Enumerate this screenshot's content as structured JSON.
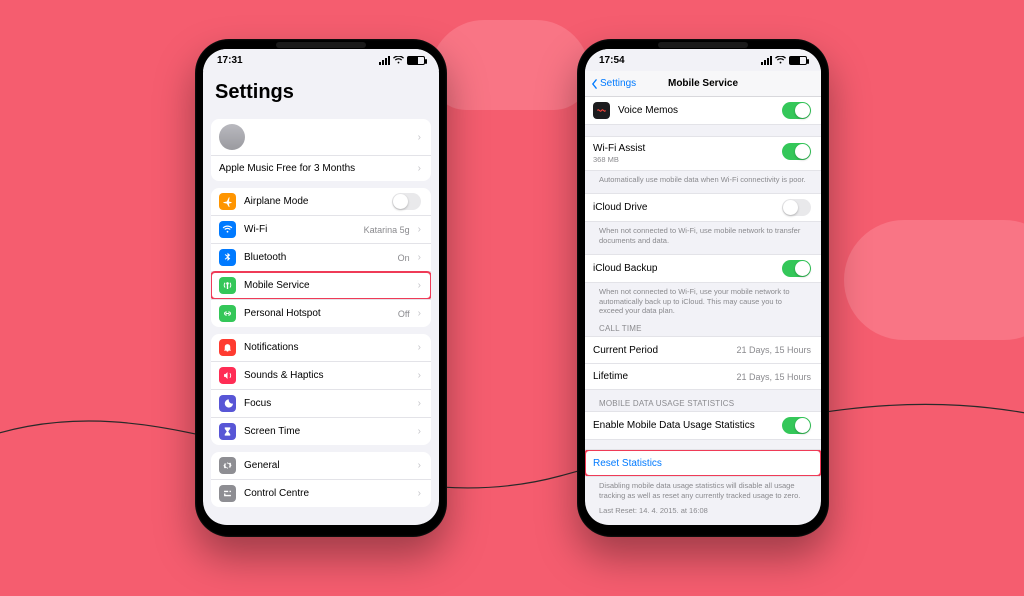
{
  "left": {
    "status": {
      "time": "17:31"
    },
    "title": "Settings",
    "account": {
      "promo": "Apple Music Free for 3 Months"
    },
    "g1": [
      {
        "icon": "airplane-icon",
        "color": "ic-orange",
        "label": "Airplane Mode",
        "toggle": false
      },
      {
        "icon": "wifi-icon",
        "color": "ic-blue",
        "label": "Wi-Fi",
        "value": "Katarina 5g"
      },
      {
        "icon": "bluetooth-icon",
        "color": "ic-blue",
        "label": "Bluetooth",
        "value": "On"
      },
      {
        "icon": "antenna-icon",
        "color": "ic-green",
        "label": "Mobile Service",
        "highlight": true
      },
      {
        "icon": "link-icon",
        "color": "ic-green",
        "label": "Personal Hotspot",
        "value": "Off"
      }
    ],
    "g2": [
      {
        "icon": "bell-icon",
        "color": "ic-red",
        "label": "Notifications"
      },
      {
        "icon": "speaker-icon",
        "color": "ic-pink",
        "label": "Sounds & Haptics"
      },
      {
        "icon": "moon-icon",
        "color": "ic-indigo",
        "label": "Focus"
      },
      {
        "icon": "hourglass-icon",
        "color": "ic-indigo",
        "label": "Screen Time"
      }
    ],
    "g3": [
      {
        "icon": "gear-icon",
        "color": "ic-grey",
        "label": "General"
      },
      {
        "icon": "switches-icon",
        "color": "ic-grey",
        "label": "Control Centre"
      }
    ]
  },
  "right": {
    "status": {
      "time": "17:54"
    },
    "nav": {
      "back": "Settings",
      "title": "Mobile Service"
    },
    "voiceMemos": {
      "label": "Voice Memos",
      "on": true
    },
    "wifiAssist": {
      "label": "Wi-Fi Assist",
      "sub": "368 MB",
      "on": true,
      "footer": "Automatically use mobile data when Wi-Fi connectivity is poor."
    },
    "icloudDrive": {
      "label": "iCloud Drive",
      "on": false,
      "footer": "When not connected to Wi-Fi, use mobile network to transfer documents and data."
    },
    "icloudBackup": {
      "label": "iCloud Backup",
      "on": true,
      "footer": "When not connected to Wi-Fi, use your mobile network to automatically back up to iCloud. This may cause you to exceed your data plan."
    },
    "callTimeHeader": "CALL TIME",
    "callTime": [
      {
        "label": "Current Period",
        "value": "21 Days, 15 Hours"
      },
      {
        "label": "Lifetime",
        "value": "21 Days, 15 Hours"
      }
    ],
    "statsHeader": "MOBILE DATA USAGE STATISTICS",
    "enableStats": {
      "label": "Enable Mobile Data Usage Statistics",
      "on": true
    },
    "reset": {
      "label": "Reset Statistics"
    },
    "disableFooter": "Disabling mobile data usage statistics will disable all usage tracking as well as reset any currently tracked usage to zero.",
    "lastReset": "Last Reset: 14. 4. 2015. at 16:08"
  }
}
